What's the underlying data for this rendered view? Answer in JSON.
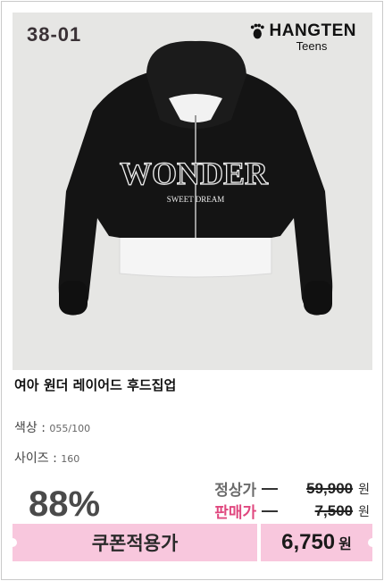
{
  "product": {
    "code": "38-01",
    "brand_name": "HANGTEN",
    "brand_sub": "Teens",
    "title": "여아 원더 레이어드 후드집업",
    "image_desc_icon": "hoodie-photo",
    "print_text_main": "WONDER",
    "print_text_sub": "SWEET DREAM"
  },
  "options": {
    "color_label": "색상 :",
    "color_value": "055/100",
    "size_label": "사이즈 :",
    "size_value": "160"
  },
  "pricing": {
    "discount": "88%",
    "regular_label": "정상가",
    "regular_price": "59,900",
    "sale_label": "판매가",
    "sale_price": "7,500",
    "currency": "원",
    "coupon_label": "쿠폰적용가",
    "final_price": "6,750",
    "final_currency": "원"
  },
  "colors": {
    "regular_label": "#6b6b6b",
    "sale_label": "#e0487f",
    "coupon_bg": "#f8c7dd"
  }
}
